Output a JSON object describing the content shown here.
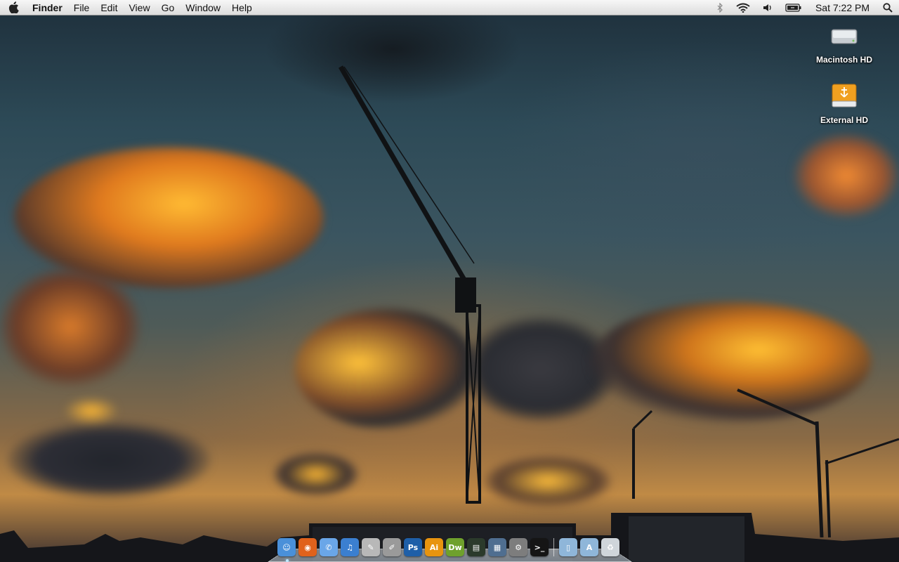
{
  "menubar": {
    "app_name": "Finder",
    "menus": [
      "File",
      "Edit",
      "View",
      "Go",
      "Window",
      "Help"
    ],
    "status_icons": [
      "bluetooth-icon",
      "wifi-icon",
      "volume-icon",
      "battery-icon"
    ],
    "clock": "Sat 7:22 PM"
  },
  "desktop_icons": [
    {
      "label": "Macintosh HD",
      "icon": "hard-drive-icon"
    },
    {
      "label": "External HD",
      "icon": "usb-drive-icon"
    }
  ],
  "dock": {
    "apps": [
      {
        "name": "Finder",
        "icon": "finder-icon",
        "color": "#4a90d9",
        "glyph": "☺"
      },
      {
        "name": "Firefox",
        "icon": "firefox-icon",
        "color": "#e0621c",
        "glyph": "◉"
      },
      {
        "name": "iChat",
        "icon": "ichat-icon",
        "color": "#6aa6e8",
        "glyph": "✆"
      },
      {
        "name": "iTunes",
        "icon": "itunes-icon",
        "color": "#3b7fd0",
        "glyph": "♫"
      },
      {
        "name": "Preview",
        "icon": "preview-icon",
        "color": "#b8b8b8",
        "glyph": "✎"
      },
      {
        "name": "Script Editor",
        "icon": "script-editor-icon",
        "color": "#9a9a9a",
        "glyph": "✐"
      },
      {
        "name": "Photoshop",
        "icon": "photoshop-icon",
        "color": "#1e5fa8",
        "glyph": "Ps"
      },
      {
        "name": "Illustrator",
        "icon": "illustrator-icon",
        "color": "#e8940f",
        "glyph": "Ai"
      },
      {
        "name": "Dreamweaver",
        "icon": "dreamweaver-icon",
        "color": "#6fa12c",
        "glyph": "Dw"
      },
      {
        "name": "Activity Monitor",
        "icon": "activity-monitor-icon",
        "color": "#2b3a2b",
        "glyph": "▤"
      },
      {
        "name": "Spaces",
        "icon": "spaces-icon",
        "color": "#4f6e90",
        "glyph": "▦"
      },
      {
        "name": "System Preferences",
        "icon": "system-preferences-icon",
        "color": "#7d7d7d",
        "glyph": "⚙"
      },
      {
        "name": "Terminal",
        "icon": "terminal-icon",
        "color": "#151515",
        "glyph": ">_"
      }
    ],
    "stacks": [
      {
        "name": "Documents",
        "icon": "documents-folder-icon",
        "color": "#8fb6d9",
        "glyph": "▯"
      },
      {
        "name": "Applications",
        "icon": "applications-folder-icon",
        "color": "#8fb6d9",
        "glyph": "A"
      },
      {
        "name": "Trash",
        "icon": "trash-icon",
        "color": "#cfd5da",
        "glyph": "♻"
      }
    ]
  }
}
